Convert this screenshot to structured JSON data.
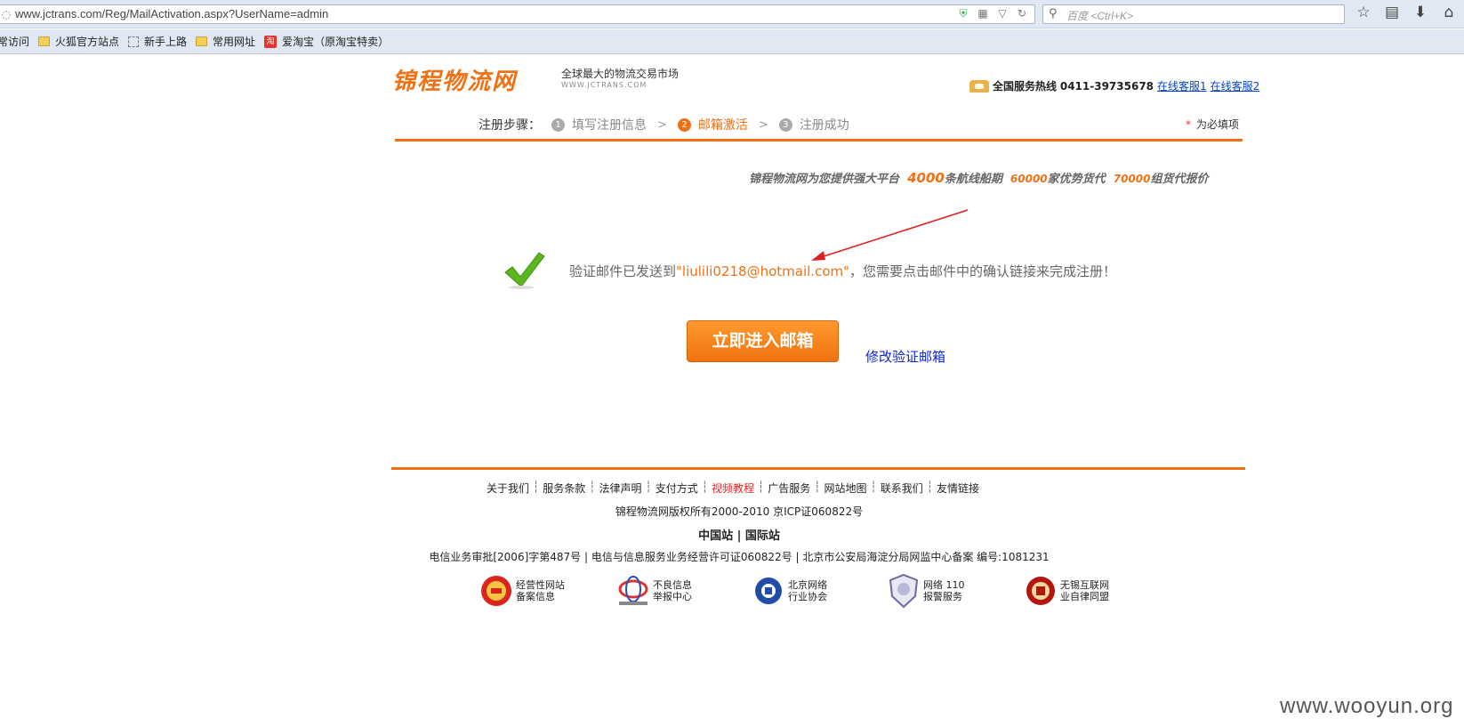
{
  "browser": {
    "url": "www.jctrans.com/Reg/MailActivation.aspx?UserName=admin",
    "search_placeholder": "百度 <Ctrl+K>",
    "bookmarks": [
      {
        "label": "常访问"
      },
      {
        "label": "火狐官方站点"
      },
      {
        "label": "新手上路"
      },
      {
        "label": "常用网址"
      },
      {
        "label": "爱淘宝（原淘宝特卖）"
      }
    ],
    "taobao_icon_text": "淘"
  },
  "header": {
    "logo": "锦程物流网",
    "slogan": "全球最大的物流交易市场",
    "logo_url": "WWW.JCTRANS.COM",
    "hotline_label": "全国服务热线",
    "hotline_number": "0411-39735678",
    "service_link_1": "在线客服1",
    "service_link_2": "在线客服2"
  },
  "steps": {
    "label": "注册步骤：",
    "items": [
      {
        "num": "1",
        "label": "填写注册信息"
      },
      {
        "num": "2",
        "label": "邮箱激活"
      },
      {
        "num": "3",
        "label": "注册成功"
      }
    ],
    "arrow": ">",
    "required_star": "*",
    "required_note": "为必填项"
  },
  "promo": {
    "prefix": "锦程物流网为您提供强大平台",
    "n1": "4000",
    "t1": "条航线船期",
    "n2": "60000",
    "t2": "家优势货代",
    "n3": "70000",
    "t3": "组货代报价"
  },
  "message": {
    "before": "验证邮件已发送到",
    "email": "\"liulili0218@hotmail.com\"",
    "after": "，您需要点击邮件中的确认链接来完成注册！",
    "enter_button": "立即进入邮箱",
    "modify_link": "修改验证邮箱"
  },
  "footer": {
    "links": [
      {
        "label": "关于我们",
        "highlight": false
      },
      {
        "label": "服务条款",
        "highlight": false
      },
      {
        "label": "法律声明",
        "highlight": false
      },
      {
        "label": "支付方式",
        "highlight": false
      },
      {
        "label": "视频教程",
        "highlight": true
      },
      {
        "label": "广告服务",
        "highlight": false
      },
      {
        "label": "网站地图",
        "highlight": false
      },
      {
        "label": "联系我们",
        "highlight": false
      },
      {
        "label": "友情链接",
        "highlight": false
      }
    ],
    "separator": "┆",
    "copyright": "锦程物流网版权所有2000-2010 京ICP证060822号",
    "station_cn": "中国站",
    "station_sep": " | ",
    "station_intl": "国际站",
    "license": "电信业务审批[2006]字第487号 | 电信与信息服务业务经营许可证060822号 | 北京市公安局海淀分局网监中心备案 编号:1081231",
    "badges": [
      {
        "text": "经营性网站\n备案信息"
      },
      {
        "text": "不良信息\n举报中心"
      },
      {
        "text": "北京网络\n行业协会"
      },
      {
        "text": "网络 110\n报警服务"
      },
      {
        "text": "无锡互联网\n业自律同盟"
      }
    ]
  },
  "watermark": "www.wooyun.org",
  "colors": {
    "accent": "#f07113",
    "link": "#0645c8",
    "modify_link": "#0d24d6"
  }
}
